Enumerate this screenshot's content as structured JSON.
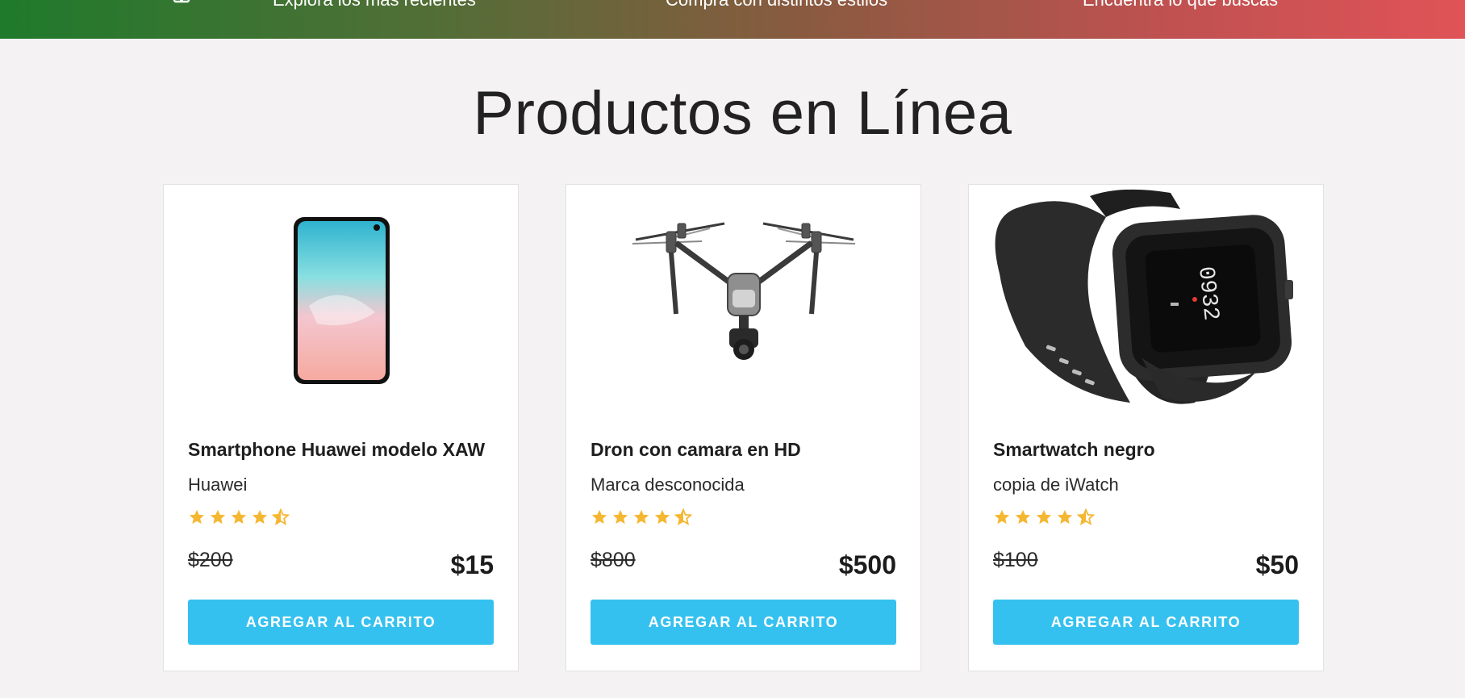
{
  "banner": {
    "items": [
      {
        "icon": "gift-icon",
        "text": "Explora los más recientes"
      },
      {
        "icon": "user-icon",
        "text": "Compra con distintos estilos"
      },
      {
        "icon": "search-icon",
        "text": "Encuentra lo que buscas"
      }
    ]
  },
  "page": {
    "title": "Productos en Línea"
  },
  "products": [
    {
      "name": "Smartphone Huawei modelo XAW",
      "brand": "Huawei",
      "rating": 4.5,
      "old_price": "$200",
      "price": "$15",
      "button": "AGREGAR AL CARRITO",
      "image": "smartphone-image"
    },
    {
      "name": "Dron con camara en HD",
      "brand": "Marca desconocida",
      "rating": 4.5,
      "old_price": "$800",
      "price": "$500",
      "button": "AGREGAR AL CARRITO",
      "image": "drone-image"
    },
    {
      "name": "Smartwatch negro",
      "brand": "copia de iWatch",
      "rating": 4.5,
      "old_price": "$100",
      "price": "$50",
      "button": "AGREGAR AL CARRITO",
      "image": "smartwatch-image"
    }
  ],
  "colors": {
    "star": "#f5b731",
    "button": "#35c1ef",
    "banner_start": "#1f7a2c",
    "banner_end": "#e05357"
  }
}
